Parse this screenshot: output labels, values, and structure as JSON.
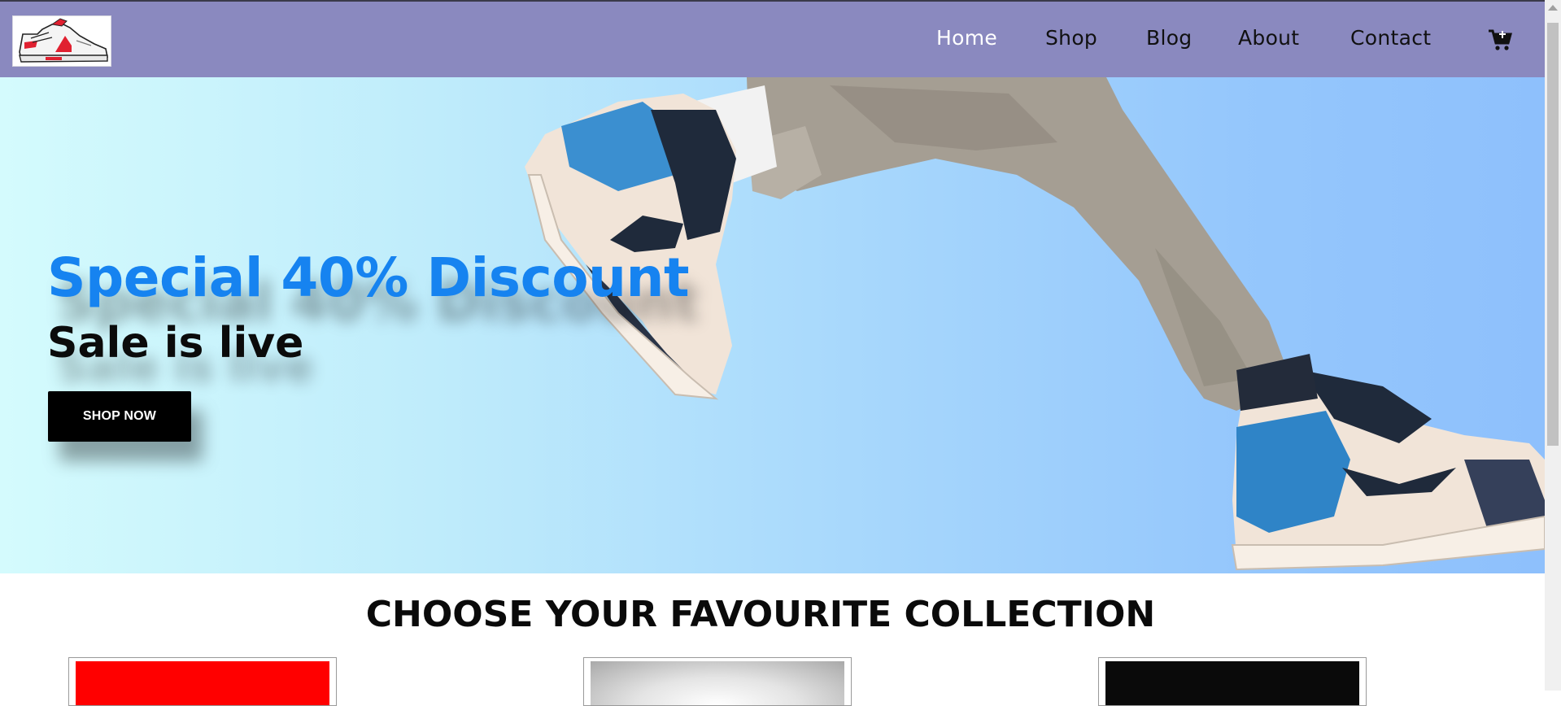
{
  "brand": {
    "logo_icon": "sneaker-logo-icon"
  },
  "nav": {
    "items": [
      {
        "label": "Home",
        "active": true
      },
      {
        "label": "Shop",
        "active": false
      },
      {
        "label": "Blog",
        "active": false
      },
      {
        "label": "About",
        "active": false
      },
      {
        "label": "Contact",
        "active": false
      }
    ],
    "cart_icon": "cart-icon"
  },
  "hero": {
    "title": "Special 40% Discount",
    "subtitle": "Sale is live",
    "cta_label": "SHOP NOW",
    "image_icon": "running-legs-sneakers-image"
  },
  "collection": {
    "heading": "CHOOSE YOUR FAVOURITE COLLECTION",
    "cards": [
      {
        "image": "red-collection-image",
        "color": "#ff0000"
      },
      {
        "image": "grey-collection-image",
        "color": "#bdbdbd"
      },
      {
        "image": "black-collection-image",
        "color": "#0a0a0a"
      }
    ]
  },
  "colors": {
    "nav_bg": "#8a89bf",
    "accent_blue": "#1683f0",
    "button_bg": "#000000"
  }
}
